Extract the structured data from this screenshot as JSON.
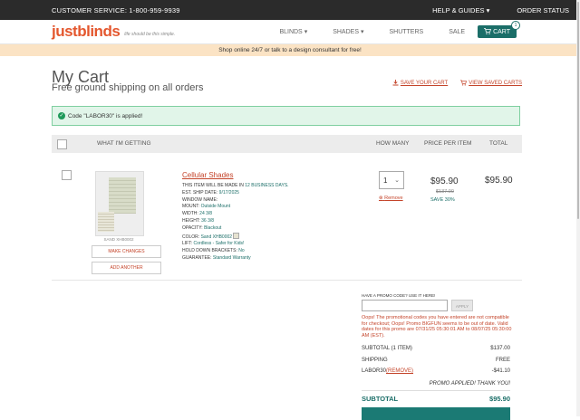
{
  "topbar": {
    "customer_service": "CUSTOMER SERVICE: 1-800-959-9939",
    "help": "HELP & GUIDES",
    "help_arrow": "▾",
    "order_status": "ORDER STATUS"
  },
  "nav": {
    "logo": "justblinds",
    "tagline": "life should be this simple.",
    "blinds": "BLINDS",
    "shades": "SHADES",
    "shutters": "SHUTTERS",
    "sale": "SALE",
    "caret": "▾",
    "cart": "CART",
    "cart_count": "1"
  },
  "banner": "Shop online 24/7 or talk to a design consultant for free!",
  "page": {
    "title": "My Cart",
    "subtitle": "Free ground shipping on all orders",
    "save_cart": "SAVE YOUR CART",
    "view_saved": "VIEW SAVED CARTS"
  },
  "alert": {
    "text": "Code \"LABOR30\" is applied!"
  },
  "table": {
    "col_item": "WHAT I'M GETTING",
    "col_qty": "HOW MANY",
    "col_price": "PRICE PER ITEM",
    "col_total": "TOTAL"
  },
  "item": {
    "name": "Cellular Shades",
    "made_prefix": "THIS ITEM WILL BE MADE IN",
    "made_days": "12 BUSINESS DAYS.",
    "ship_label": "EST. SHIP DATE:",
    "ship_date": "9/17/2025",
    "window_label": "WINDOW NAME:",
    "mount_label": "MOUNT:",
    "mount": "Outside Mount",
    "width_label": "WIDTH:",
    "width": "24 3/8",
    "height_label": "HEIGHT:",
    "height": "36 3/8",
    "opacity_label": "OPACITY:",
    "opacity": "Blackout",
    "color_label": "COLOR:",
    "color": "Sand XHB0002",
    "lift_label": "LIFT:",
    "lift": "Cordless - Safer for Kids!",
    "bracket_label": "HOLD DOWN BRACKETS:",
    "bracket": "No",
    "guarantee_label": "GUARANTEE:",
    "guarantee": "Standard Warranty",
    "sku": "SAND XHB0002",
    "make_changes": "MAKE CHANGES",
    "add_another": "ADD ANOTHER",
    "qty": "1",
    "remove": "Remove",
    "price": "$95.90",
    "old_price": "$137.00",
    "save": "SAVE 30%",
    "total": "$95.90"
  },
  "promo": {
    "label": "HAVE A PROMO CODE? USE IT HERE!",
    "apply": "APPLY",
    "error": "Oops! The promotional codes you have entered are not compatible for checkout; Oops! Promo BIGFUN seems to be out of date. Valid dates for this promo are 07/31/25 05:30:01 AM to 08/07/25 05:30:00 AM (EST)."
  },
  "summary": {
    "subtotal_label": "SUBTOTAL (1 ITEM)",
    "subtotal": "$137.00",
    "shipping_label": "SHIPPING",
    "shipping": "FREE",
    "code_label": "LABOR30",
    "remove": "(REMOVE)",
    "discount": "-$41.10",
    "applied": "PROMO APPLIED! THANK YOU!",
    "total_label": "SUBTOTAL",
    "total": "$95.90"
  },
  "colors": {
    "brand": "#e4572e",
    "teal": "#1b6e68",
    "alert_bg": "#e1f5e9",
    "banner_bg": "#fbe3c4"
  }
}
